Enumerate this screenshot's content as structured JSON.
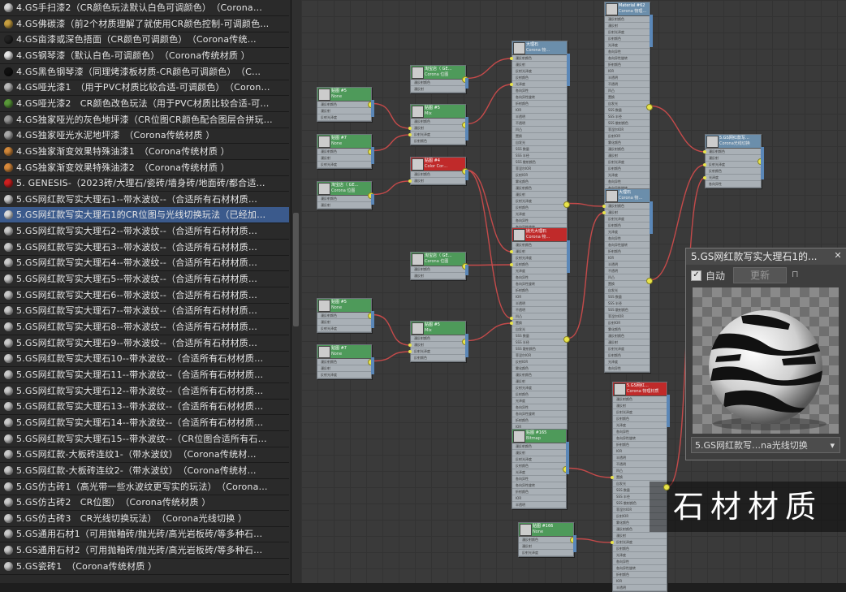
{
  "materials": [
    {
      "label": "4.GS手扫漆2（CR颜色玩法默认白色可调颜色）　（Corona…",
      "color": "#d8d8d8",
      "selected": false
    },
    {
      "label": "4.GS佛碳漆（前2个材质理解了就使用CR颜色控制-可调颜色…",
      "color": "#c8a040",
      "selected": false
    },
    {
      "label": "4.GS亩漆或深色捂面（CR颜色可调颜色）　（Corona传统…",
      "color": "#222222",
      "selected": false
    },
    {
      "label": "4.GS钢琴漆（默认白色-可调颜色）　（Corona传统材质 ）",
      "color": "#e8e8e8",
      "selected": false
    },
    {
      "label": "4.GS黑色钢琴漆（同理烤漆板材质-CR颜色可调颜色）　（C…",
      "color": "#111111",
      "selected": false
    },
    {
      "label": "4.GS哑光漆1　（用于PVC材质比较合适-可调颜色）　（Coron…",
      "color": "#bbbbbb",
      "selected": false
    },
    {
      "label": "4.GS哑光漆2　CR颜色改色玩法（用于PVC材质比较合适-可…",
      "color": "#5a9a3a",
      "selected": false
    },
    {
      "label": "4.GS独家哑光的灰色地坪漆（CR位图CR颜色配合图层合拼玩…",
      "color": "#999999",
      "selected": false
    },
    {
      "label": "4.GS独家哑光水泥地坪漆　（Corona传统材质 ）",
      "color": "#aaaaaa",
      "selected": false
    },
    {
      "label": "4.GS独家渐变效果特殊油漆1　（Corona传统材质 ）",
      "color": "#d2883a",
      "selected": false
    },
    {
      "label": "4.GS独家渐变效果特殊油漆2　（Corona传统材质 ）",
      "color": "#d88a3c",
      "selected": false
    },
    {
      "label": "5. GENESIS-（2023砖/大理石/瓷砖/墙身砖/地面砖/都合适…",
      "color": "#d12020",
      "selected": false
    },
    {
      "label": "5.GS网红款写实大理石1--带水波纹--（合适所有石材材质…",
      "color": "#cfcfcf",
      "selected": false
    },
    {
      "label": "5.GS网红款写实大理石1的CR位图与光线切换玩法（已经加…",
      "color": "#dddddd",
      "selected": true
    },
    {
      "label": "5.GS网红款写实大理石2--带水波纹--（合适所有石材材质…",
      "color": "#cccccc",
      "selected": false
    },
    {
      "label": "5.GS网红款写实大理石3--带水波纹--（合适所有石材材质…",
      "color": "#cccccc",
      "selected": false
    },
    {
      "label": "5.GS网红款写实大理石4--带水波纹--（合适所有石材材质…",
      "color": "#cccccc",
      "selected": false
    },
    {
      "label": "5.GS网红款写实大理石5--带水波纹--（合适所有石材材质…",
      "color": "#cccccc",
      "selected": false
    },
    {
      "label": "5.GS网红款写实大理石6--带水波纹--（合适所有石材材质…",
      "color": "#cccccc",
      "selected": false
    },
    {
      "label": "5.GS网红款写实大理石7--带水波纹--（合适所有石材材质…",
      "color": "#cccccc",
      "selected": false
    },
    {
      "label": "5.GS网红款写实大理石8--带水波纹--（合适所有石材材质…",
      "color": "#cccccc",
      "selected": false
    },
    {
      "label": "5.GS网红款写实大理石9--带水波纹--（合适所有石材材质…",
      "color": "#cccccc",
      "selected": false
    },
    {
      "label": "5.GS网红款写实大理石10--带水波纹--（合适所有石材材质…",
      "color": "#cccccc",
      "selected": false
    },
    {
      "label": "5.GS网红款写实大理石11--带水波纹--（合适所有石材材质…",
      "color": "#cccccc",
      "selected": false
    },
    {
      "label": "5.GS网红款写实大理石12--带水波纹--（合适所有石材材质…",
      "color": "#cccccc",
      "selected": false
    },
    {
      "label": "5.GS网红款写实大理石13--带水波纹--（合适所有石材材质…",
      "color": "#cccccc",
      "selected": false
    },
    {
      "label": "5.GS网红款写实大理石14--带水波纹--（合适所有石材材质…",
      "color": "#cccccc",
      "selected": false
    },
    {
      "label": "5.GS网红款写实大理石15--带水波纹--（CR位图合适所有石…",
      "color": "#cccccc",
      "selected": false
    },
    {
      "label": "5.GS网红款-大板砖连纹1-（带水波纹）　（Corona传统材…",
      "color": "#cccccc",
      "selected": false
    },
    {
      "label": "5.GS网红款-大板砖连纹2-（带水波纹）　（Corona传统材…",
      "color": "#cccccc",
      "selected": false
    },
    {
      "label": "5.GS仿古砖1（高光带一些水波纹更写实的玩法）　（Corona…",
      "color": "#cccccc",
      "selected": false
    },
    {
      "label": "5.GS仿古砖2　CR位图）　（Corona传统材质 ）",
      "color": "#cccccc",
      "selected": false
    },
    {
      "label": "5.GS仿古砖3　CR光线切换玩法）　（Corona光线切换 ）",
      "color": "#cccccc",
      "selected": false
    },
    {
      "label": "5.GS通用石材1（可用抛釉砖/抛光砖/高光岩板砖/等多种石…",
      "color": "#cccccc",
      "selected": false
    },
    {
      "label": "5.GS通用石材2（可用抛釉砖/抛光砖/高光岩板砖/等多种石…",
      "color": "#cccccc",
      "selected": false
    },
    {
      "label": "5.GS瓷砖1　（Corona传统材质 ）",
      "color": "#cccccc",
      "selected": false
    }
  ],
  "nodes": {
    "material62": {
      "title": "Material #62",
      "sub": "Corona 物理…"
    },
    "dalishi1": {
      "title": "大理石",
      "sub": "Corona 物…"
    },
    "bitmap5a": {
      "title": "贴图 #5",
      "sub": "None"
    },
    "taobao1": {
      "title": "淘宝店（ GE…",
      "sub": "Corona 位图"
    },
    "mix5a": {
      "title": "贴图 #5",
      "sub": "Mix"
    },
    "bitmap7a": {
      "title": "贴图 #7",
      "sub": "None"
    },
    "colorcor": {
      "title": "贴图 #4",
      "sub": "Color Cor…"
    },
    "taobao2": {
      "title": "淘宝店（ GE…",
      "sub": "Corona 位图"
    },
    "guangxian": {
      "title": "5.GS网红款写…",
      "sub": "Corona光线切换"
    },
    "dalishi2": {
      "title": "大理石",
      "sub": "Corona 物…"
    },
    "taobao3": {
      "title": "淘宝店（ GE…",
      "sub": "Corona 位图"
    },
    "rayswitch": {
      "title": "抛光大理石",
      "sub": "Corona 物…"
    },
    "bitmap5b": {
      "title": "贴图 #5",
      "sub": "None"
    },
    "mix5b": {
      "title": "贴图 #5",
      "sub": "Mix"
    },
    "bitmap7b": {
      "title": "贴图 #7",
      "sub": "None"
    },
    "bitmap165": {
      "title": "贴图 #165",
      "sub": "Bitmap"
    },
    "material_red": {
      "title": "5.GS网红…",
      "sub": "Corona 物理材质"
    },
    "bitmap166": {
      "title": "贴图 #166",
      "sub": "None"
    }
  },
  "preview": {
    "title": "5.GS网红款写实大理石1的...",
    "auto_label": "自动",
    "update_label": "更新",
    "auto_checked": "✓",
    "select_value": "5.GS网红款写…na光线切换"
  },
  "watermark": "石材材质"
}
